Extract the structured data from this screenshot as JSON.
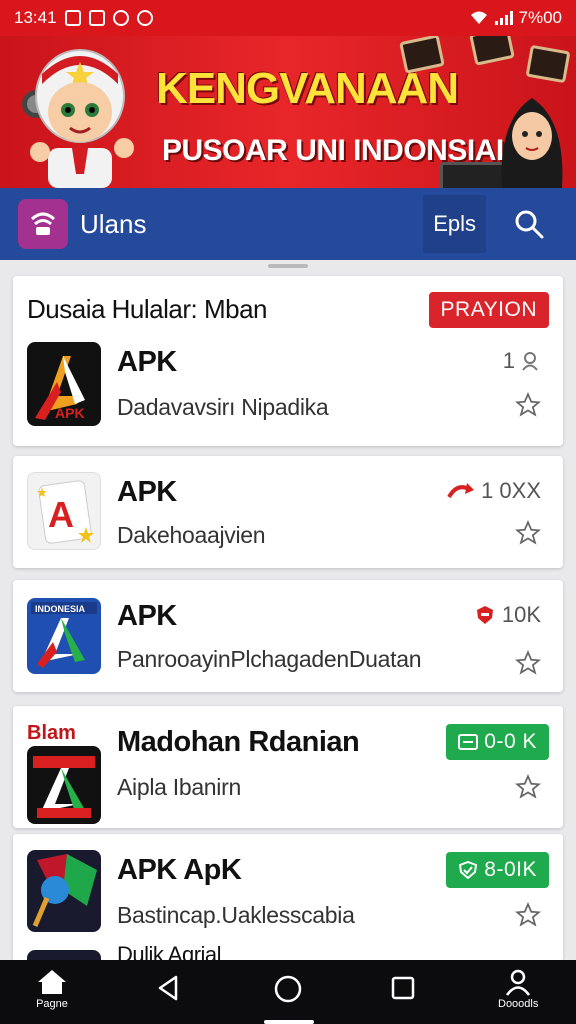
{
  "status_bar": {
    "time": "13:41",
    "right_text": "7%00"
  },
  "banner": {
    "title": "KENGVANAAN",
    "subtitle": "PUSOAR UNI INDONSIAI"
  },
  "app_bar": {
    "app_name": "Ulans",
    "action_label": "Epls",
    "search_icon": "search-icon"
  },
  "section": {
    "title": "Dusaia Hulalar: Mban",
    "badge": "PRAYION"
  },
  "apps": [
    {
      "title": "APK",
      "desc": "Dadavavsirı Nipadika",
      "count": "1",
      "count_icon": "person-icon"
    },
    {
      "title": "APK",
      "desc": "Dakehoaajvien",
      "count": "1 0XX",
      "count_icon": "red-arrow-icon"
    },
    {
      "title": "APK",
      "desc": "PanrooayinPlchagadenDuatan",
      "count": "10K",
      "count_icon": "red-shield-icon"
    },
    {
      "title": "Madohan Rdanian",
      "desc": "Aipla Ibanirn",
      "badge": "0-0 K",
      "tiny_label": "Blam"
    },
    {
      "title": "APK ApK",
      "desc": "Bastincap.Uaklesscabia",
      "badge": "8-0IK"
    }
  ],
  "partial_title": "Dulik Aqrial",
  "bottom_nav": {
    "left_label": "Pagne",
    "right_label": "Dooodls"
  },
  "colors": {
    "status_red": "#d8161b",
    "app_bar_blue": "#254a9c",
    "badge_red": "#d8242a",
    "badge_green": "#1faa4d"
  }
}
